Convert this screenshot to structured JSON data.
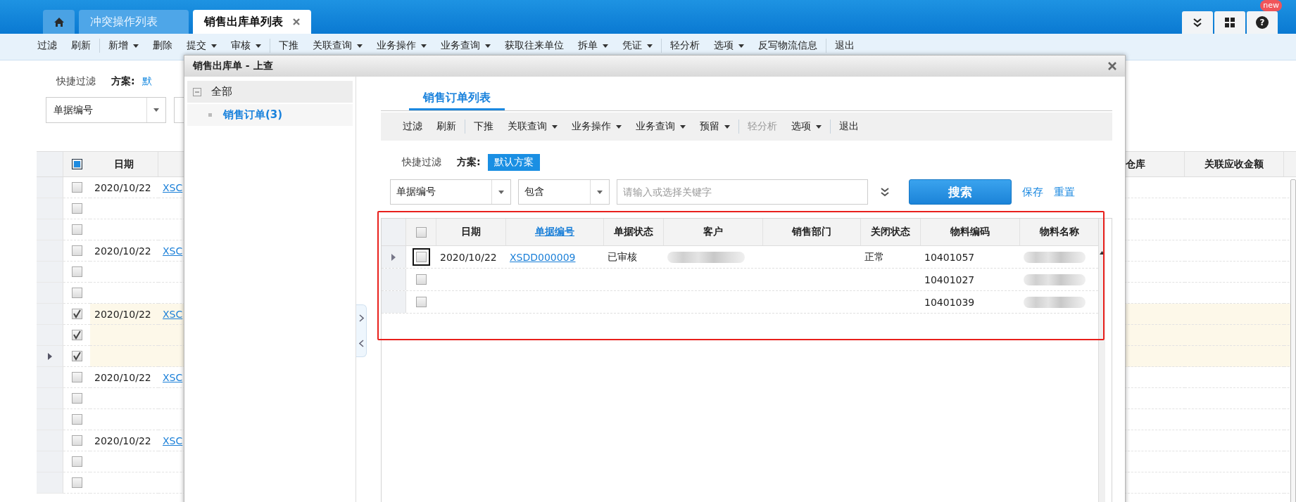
{
  "top_bar": {
    "tabs": [
      {
        "kind": "home",
        "selected": false
      },
      {
        "kind": "page",
        "label": "冲突操作列表",
        "selected": false
      },
      {
        "kind": "page",
        "label": "销售出库单列表",
        "selected": true,
        "closable": true
      }
    ],
    "tools": [
      {
        "kind": "expand"
      },
      {
        "kind": "apps"
      },
      {
        "kind": "help",
        "symbol": "?",
        "badge": "new"
      }
    ]
  },
  "toolbar": [
    {
      "kind": "button",
      "label": "过滤"
    },
    {
      "kind": "button",
      "label": "刷新"
    },
    {
      "kind": "separator"
    },
    {
      "kind": "button",
      "label": "新增",
      "dropdown": true
    },
    {
      "kind": "button",
      "label": "删除"
    },
    {
      "kind": "button",
      "label": "提交",
      "dropdown": true
    },
    {
      "kind": "button",
      "label": "审核",
      "dropdown": true
    },
    {
      "kind": "separator"
    },
    {
      "kind": "button",
      "label": "下推"
    },
    {
      "kind": "button",
      "label": "关联查询",
      "dropdown": true
    },
    {
      "kind": "button",
      "label": "业务操作",
      "dropdown": true
    },
    {
      "kind": "button",
      "label": "业务查询",
      "dropdown": true
    },
    {
      "kind": "button",
      "label": "获取往来单位"
    },
    {
      "kind": "button",
      "label": "拆单",
      "dropdown": true
    },
    {
      "kind": "button",
      "label": "凭证",
      "dropdown": true
    },
    {
      "kind": "separator"
    },
    {
      "kind": "button",
      "label": "轻分析"
    },
    {
      "kind": "button",
      "label": "选项",
      "dropdown": true
    },
    {
      "kind": "button",
      "label": "反写物流信息"
    },
    {
      "kind": "separator"
    },
    {
      "kind": "button",
      "label": "退出"
    }
  ],
  "quick_filter": {
    "label": "快捷过滤",
    "scheme_label": "方案:",
    "scheme": "默"
  },
  "search": {
    "field": "单据编号"
  },
  "grid": {
    "header_checkbox": {
      "indeterminate": true
    },
    "columns": [
      {
        "label": "日期"
      },
      {
        "label": "仓库"
      },
      {
        "label": "关联应收金额"
      }
    ],
    "rows": [
      {
        "current": false,
        "checked": false,
        "date": "2020/10/22",
        "number": "XSC"
      },
      {
        "current": false,
        "checked": false
      },
      {
        "current": false,
        "checked": false
      },
      {
        "current": false,
        "checked": false,
        "date": "2020/10/22",
        "number": "XSC"
      },
      {
        "current": false,
        "checked": false
      },
      {
        "current": false,
        "checked": false
      },
      {
        "current": false,
        "checked": true,
        "date": "2020/10/22",
        "number": "XSC"
      },
      {
        "current": false,
        "checked": true
      },
      {
        "current": true,
        "checked": true
      },
      {
        "current": false,
        "checked": false,
        "date": "2020/10/22",
        "number": "XSC"
      },
      {
        "current": false,
        "checked": false
      },
      {
        "current": false,
        "checked": false
      },
      {
        "current": false,
        "checked": false,
        "date": "2020/10/22",
        "number": "XSC"
      },
      {
        "current": false,
        "checked": false
      },
      {
        "current": false,
        "checked": false
      }
    ]
  },
  "dialog": {
    "title": "销售出库单 - 上查",
    "tree": [
      {
        "label": "全部",
        "expanded": true,
        "selected": false,
        "children": [
          {
            "label": "销售订单(3)",
            "selected": true
          }
        ]
      }
    ],
    "tabs": [
      {
        "label": "销售订单列表",
        "selected": true
      }
    ],
    "toolbar": [
      {
        "kind": "button",
        "label": "过滤"
      },
      {
        "kind": "button",
        "label": "刷新"
      },
      {
        "kind": "separator"
      },
      {
        "kind": "button",
        "label": "下推"
      },
      {
        "kind": "button",
        "label": "关联查询",
        "dropdown": true
      },
      {
        "kind": "button",
        "label": "业务操作",
        "dropdown": true
      },
      {
        "kind": "button",
        "label": "业务查询",
        "dropdown": true
      },
      {
        "kind": "button",
        "label": "预留",
        "dropdown": true
      },
      {
        "kind": "separator"
      },
      {
        "kind": "button",
        "label": "轻分析",
        "disabled": true
      },
      {
        "kind": "button",
        "label": "选项",
        "dropdown": true
      },
      {
        "kind": "separator"
      },
      {
        "kind": "button",
        "label": "退出"
      }
    ],
    "quick_filter": {
      "label": "快捷过滤",
      "scheme_label": "方案:",
      "schemes": [
        {
          "label": "默认方案",
          "selected": true
        }
      ]
    },
    "search": {
      "field": "单据编号",
      "operator": "包含",
      "placeholder": "请输入或选择关键字",
      "button": "搜索",
      "links": [
        "保存",
        "重置"
      ]
    },
    "grid": {
      "header_checkbox": {
        "checked": false
      },
      "columns": [
        {
          "label": "日期",
          "link": false
        },
        {
          "label": "单据编号",
          "link": true
        },
        {
          "label": "单据状态",
          "link": false
        },
        {
          "label": "客户",
          "link": false
        },
        {
          "label": "销售部门",
          "link": false
        },
        {
          "label": "关闭状态",
          "link": false
        },
        {
          "label": "物料编码",
          "link": false
        },
        {
          "label": "物料名称",
          "link": false
        }
      ],
      "rows": [
        {
          "current": true,
          "focused": true,
          "checked": false,
          "date": "2020/10/22",
          "number": "XSDD000009",
          "status": "已审核",
          "customer_blurred": true,
          "close_status": "正常",
          "material_code": "10401057",
          "material_name_blurred": true
        },
        {
          "current": false,
          "checked": false,
          "material_code": "10401027",
          "material_name_blurred": true
        },
        {
          "current": false,
          "checked": false,
          "material_code": "10401039",
          "material_name_blurred": true
        }
      ]
    }
  }
}
